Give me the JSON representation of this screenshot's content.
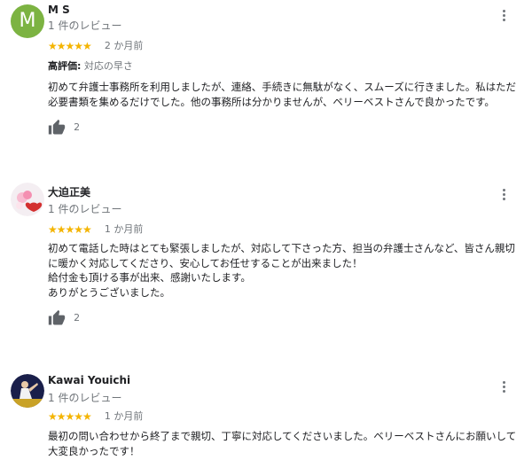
{
  "reviews": [
    {
      "avatar_letter": "M",
      "name": "M S",
      "review_count": "1 件のレビュー",
      "stars": "★★★★★",
      "date": "2 か月前",
      "highlight_label": "高評価:",
      "highlight_value": "対応の早さ",
      "text": "初めて弁護士事務所を利用しましたが、連絡、手続きに無駄がなく、スムーズに行きました。私はただ必要書類を集めるだけでした。他の事務所は分かりませんが、ベリーベストさんで良かったです。",
      "likes": "2"
    },
    {
      "name": "大迫正美",
      "review_count": "1 件のレビュー",
      "stars": "★★★★★",
      "date": "1 か月前",
      "text": "初めて電話した時はとても緊張しましたが、対応して下さった方、担当の弁護士さんなど、皆さん親切に暖かく対応してくださり、安心してお任せすることが出来ました！\n給付金も頂ける事が出来、感謝いたします。\nありがとうございました。",
      "likes": "2"
    },
    {
      "name": "Kawai Youichi",
      "review_count": "1 件のレビュー",
      "stars": "★★★★★",
      "date": "1 か月前",
      "text": "最初の問い合わせから終了まで親切、丁寧に対応してくださいました。ベリーベストさんにお願いして大変良かったです！"
    }
  ],
  "colors": {
    "star": "#f4b400",
    "avatar_m": "#7cb342",
    "secondary_text": "#70757a"
  }
}
